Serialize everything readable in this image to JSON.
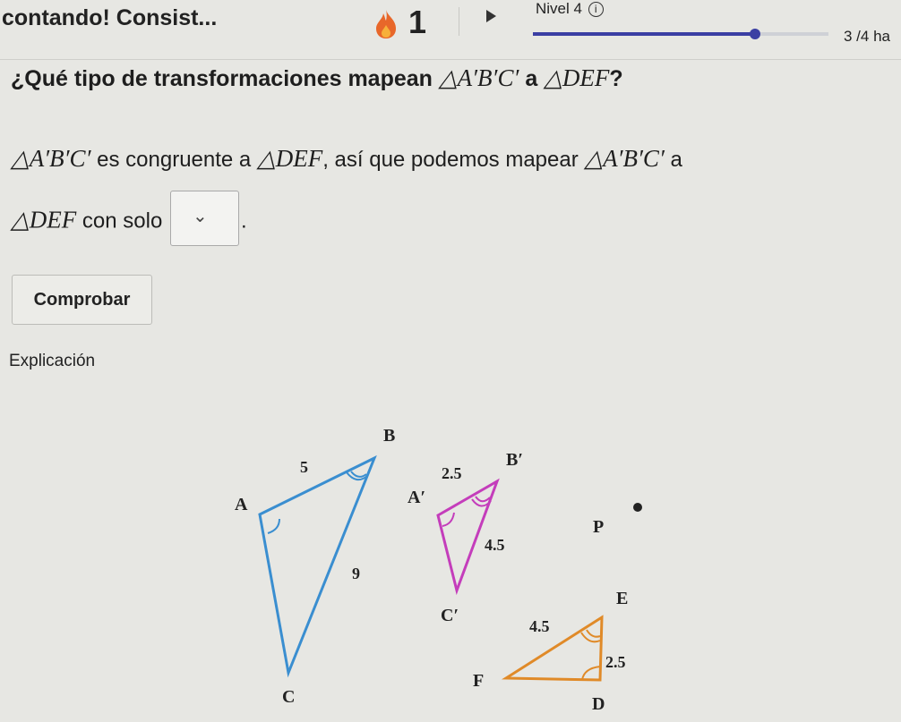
{
  "header": {
    "title": "contando! Consist...",
    "streak": "1",
    "level_label": "Nivel 4",
    "info_icon": "info-circle-icon",
    "progress": 0.75,
    "count": "3 /4 ha"
  },
  "question": {
    "prefix": "¿Qué tipo de transformaciones mapean ",
    "tri1": "△A′B′C′",
    "middle": " a ",
    "tri2": "△DEF",
    "suffix": "?"
  },
  "statement": {
    "tri1": "△A′B′C′",
    "text1": " es congruente a ",
    "tri2": "△DEF",
    "text2": ", así que podemos mapear ",
    "tri3": "△A′B′C′",
    "text3": " a",
    "tri4": "△DEF",
    "text4": " con solo ",
    "dropdown_icon": "chevron-down-icon",
    "end": "."
  },
  "check_button": "Comprobar",
  "explanation_link": "Explicación",
  "colors": {
    "triangle_abc": "#3a8ed0",
    "triangle_a1b1c1": "#c43dbb",
    "triangle_def": "#e08a28",
    "progress": "#3b3fa3",
    "flame": "#e8672a"
  },
  "figure": {
    "abc": {
      "A": "A",
      "B": "B",
      "C": "C",
      "side_ab": "5",
      "side_bc": "9"
    },
    "a1b1c1": {
      "A": "A′",
      "B": "B′",
      "C": "C′",
      "side_ab": "2.5",
      "side_bc": "4.5"
    },
    "def": {
      "D": "D",
      "E": "E",
      "F": "F",
      "side_ef": "4.5",
      "side_ed": "2.5"
    },
    "point": "P"
  }
}
